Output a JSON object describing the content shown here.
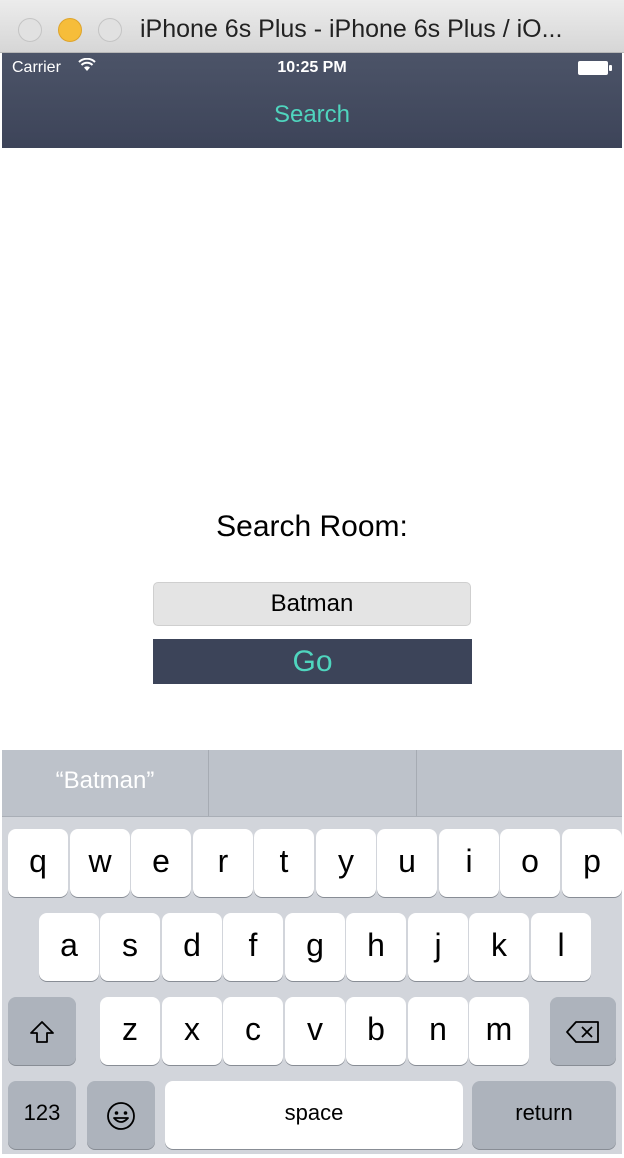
{
  "window": {
    "title": "iPhone 6s Plus - iPhone 6s Plus / iO..."
  },
  "status_bar": {
    "carrier": "Carrier",
    "time": "10:25 PM"
  },
  "nav": {
    "title": "Search"
  },
  "main": {
    "label": "Search Room:",
    "search_value": "Batman",
    "go_label": "Go"
  },
  "keyboard": {
    "suggestions": [
      "“Batman”",
      "",
      ""
    ],
    "row1": [
      "q",
      "w",
      "e",
      "r",
      "t",
      "y",
      "u",
      "i",
      "o",
      "p"
    ],
    "row2": [
      "a",
      "s",
      "d",
      "f",
      "g",
      "h",
      "j",
      "k",
      "l"
    ],
    "row3": [
      "z",
      "x",
      "c",
      "v",
      "b",
      "n",
      "m"
    ],
    "numbers_label": "123",
    "space_label": "space",
    "return_label": "return"
  },
  "colors": {
    "accent": "#4fd5be",
    "navbar": "#3d4459",
    "button": "#3c4459"
  }
}
